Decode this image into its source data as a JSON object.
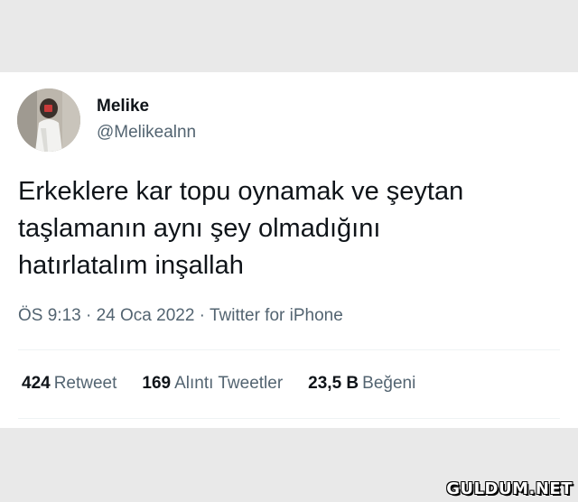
{
  "tweet": {
    "author_name": "Melike",
    "author_handle": "@Melikealnn",
    "text_lines": [
      "Erkeklere kar topu oynamak ve şeytan",
      "taşlamanın aynı şey olmadığını",
      "hatırlatalım inşallah"
    ],
    "meta": "ÖS 9:13 · 24 Oca 2022 · Twitter for iPhone",
    "stats": [
      {
        "count": "424",
        "label": "Retweet"
      },
      {
        "count": "169",
        "label": "Alıntı Tweetler"
      },
      {
        "count": "23,5 B",
        "label": "Beğeni"
      }
    ]
  },
  "watermark": "GULDUM.NET",
  "colors": {
    "background": "#e9e9e9",
    "card": "#ffffff",
    "text": "#0f1419",
    "secondary_text": "#536471",
    "divider": "#eff3f4"
  }
}
